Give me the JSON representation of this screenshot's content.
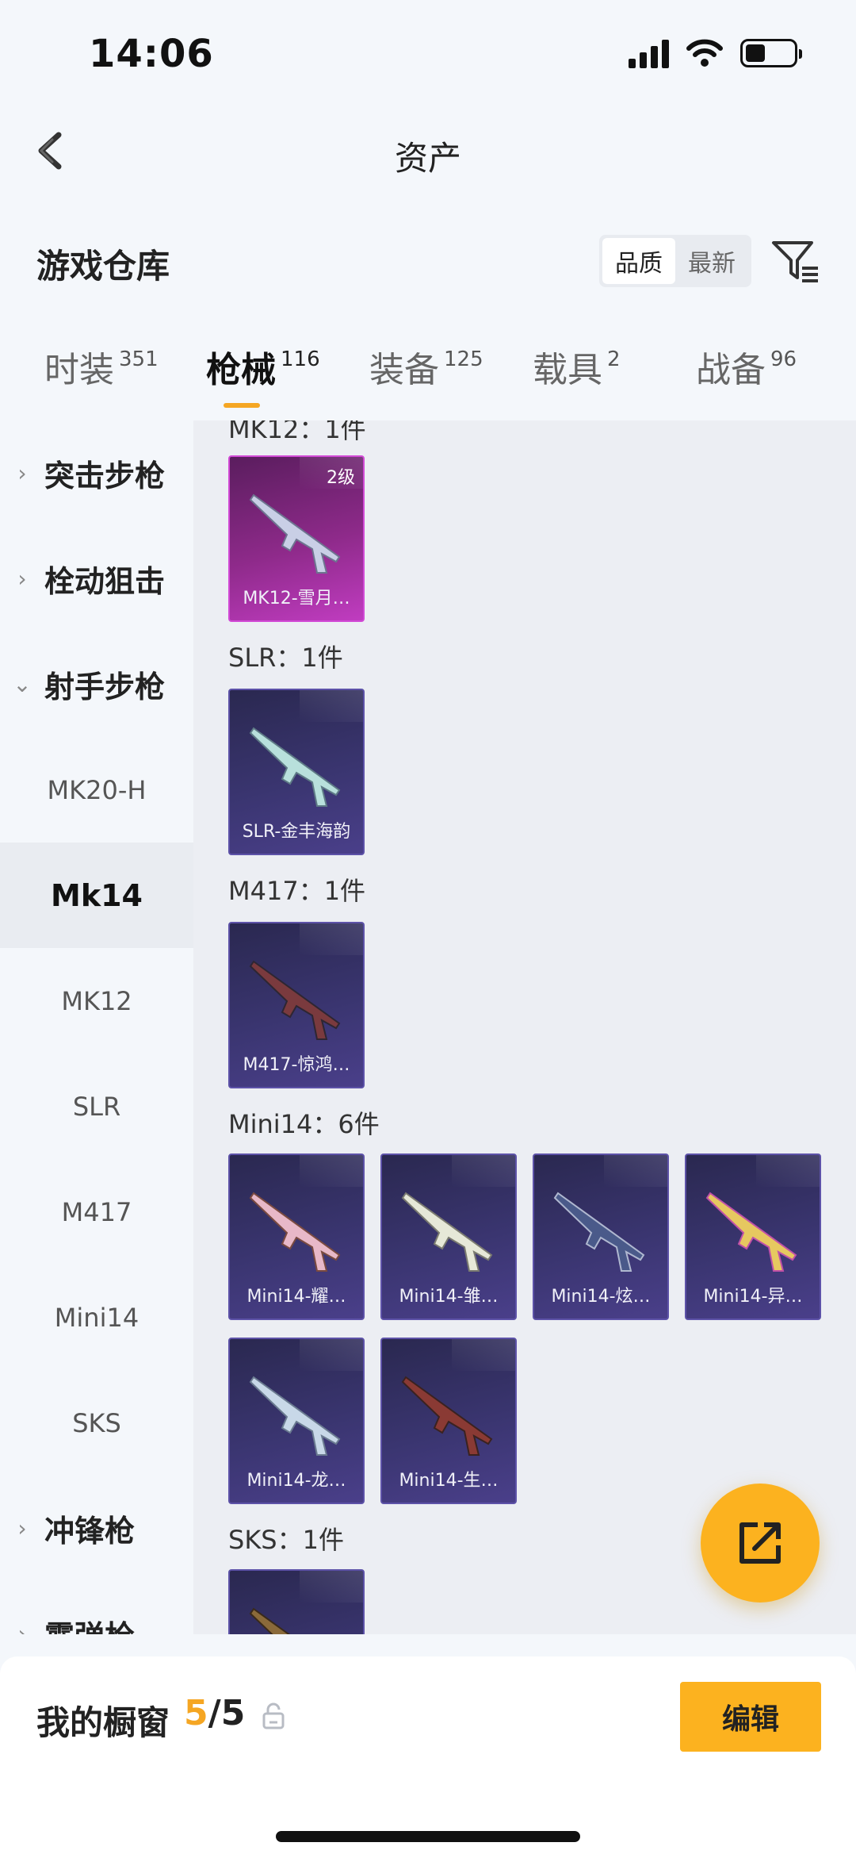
{
  "status": {
    "time": "14:06"
  },
  "nav": {
    "title": "资产"
  },
  "section": {
    "title": "游戏仓库"
  },
  "sort": {
    "options": [
      "品质",
      "最新"
    ]
  },
  "tabs": [
    {
      "label": "时装",
      "count": "351"
    },
    {
      "label": "枪械",
      "count": "116"
    },
    {
      "label": "装备",
      "count": "125"
    },
    {
      "label": "载具",
      "count": "2"
    },
    {
      "label": "战备",
      "count": "96"
    }
  ],
  "sidebar": {
    "categories": [
      "突击步枪",
      "栓动狙击",
      "射手步枪",
      "冲锋枪",
      "霰弹枪"
    ],
    "subitems": [
      "MK20-H",
      "Mk14",
      "MK12",
      "SLR",
      "M417",
      "Mini14",
      "SKS"
    ]
  },
  "groups": [
    {
      "title": "MK12：1件",
      "items": [
        {
          "name": "MK12-雪月…",
          "level": "2级"
        }
      ]
    },
    {
      "title": "SLR：1件",
      "items": [
        {
          "name": "SLR-金丰海韵"
        }
      ]
    },
    {
      "title": "M417：1件",
      "items": [
        {
          "name": "M417-惊鸿…"
        }
      ]
    },
    {
      "title": "Mini14：6件",
      "items": [
        {
          "name": "Mini14-耀…"
        },
        {
          "name": "Mini14-雏…"
        },
        {
          "name": "Mini14-炫…"
        },
        {
          "name": "Mini14-异…"
        },
        {
          "name": "Mini14-龙…"
        },
        {
          "name": "Mini14-生…"
        }
      ]
    },
    {
      "title": "SKS：1件",
      "items": []
    }
  ],
  "showcase": {
    "label": "我的橱窗",
    "current": "5",
    "total": "/5"
  },
  "actions": {
    "edit_label": "编辑"
  }
}
